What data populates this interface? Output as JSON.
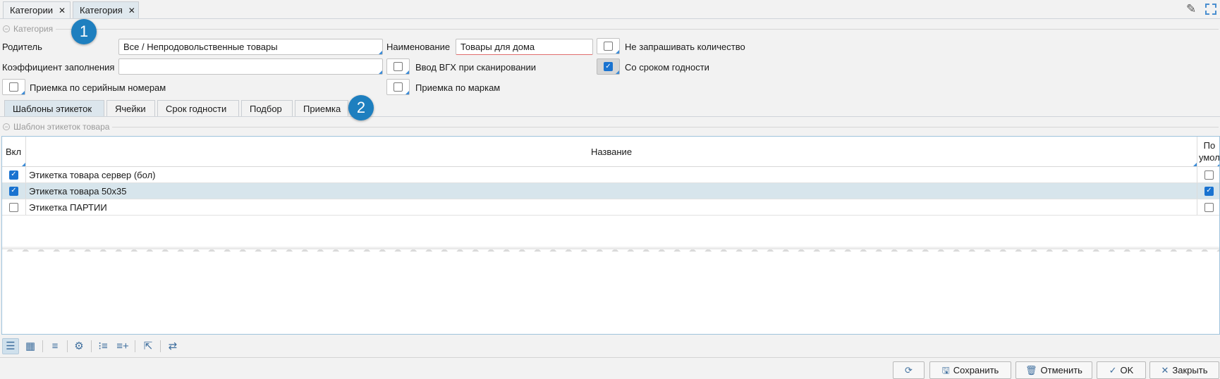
{
  "tabs": [
    {
      "label": "Категории",
      "active": false
    },
    {
      "label": "Категория",
      "active": true
    }
  ],
  "toolbar_icons": [
    "pencil-icon",
    "fullscreen-icon"
  ],
  "form": {
    "section_title": "Категория",
    "parent_label": "Родитель",
    "parent_value": "Все / Непродовольственные товары",
    "name_label": "Наименование",
    "name_value": "Товары для дома",
    "no_qty_label": "Не запрашивать количество",
    "no_qty_checked": false,
    "fill_coef_label": "Коэффициент заполнения",
    "fill_coef_value": "",
    "vgh_label": "Ввод ВГХ при сканировании",
    "vgh_checked": false,
    "expiry_label": "Со сроком годности",
    "expiry_checked": true,
    "serial_label": "Приемка по серийным номерам",
    "serial_checked": false,
    "marks_label": "Приемка по маркам",
    "marks_checked": false
  },
  "badges": [
    "1",
    "2"
  ],
  "subtabs": [
    {
      "label": "Шаблоны этикеток",
      "active": true
    },
    {
      "label": "Ячейки",
      "active": false
    },
    {
      "label": "Срок годности",
      "active": false
    },
    {
      "label": "Подбор",
      "active": false
    },
    {
      "label": "Приемка",
      "active": false
    }
  ],
  "grid": {
    "section_title": "Шаблон этикеток товара",
    "columns": [
      "Вкл",
      "Название",
      "По умол"
    ],
    "rows": [
      {
        "enabled": true,
        "name": "Этикетка товара сервер (бол)",
        "default": false,
        "selected": false
      },
      {
        "enabled": true,
        "name": "Этикетка товара 50х35",
        "default": true,
        "selected": true
      },
      {
        "enabled": false,
        "name": "Этикетка ПАРТИИ",
        "default": false,
        "selected": false
      }
    ]
  },
  "grid_toolbar": [
    "list-view-icon",
    "table-view-icon",
    "filter-icon",
    "settings-icon",
    "numbered-list-icon",
    "add-row-icon",
    "export-icon",
    "transfer-icon"
  ],
  "buttons": {
    "refresh_icon": "refresh-icon",
    "save": "Сохранить",
    "cancel": "Отменить",
    "ok": "OK",
    "close": "Закрыть"
  },
  "colors": {
    "accent": "#1a73d0",
    "badge": "#1e7fbf",
    "selected_row": "#d7e5ec",
    "required_underline": "#e06d6d"
  }
}
